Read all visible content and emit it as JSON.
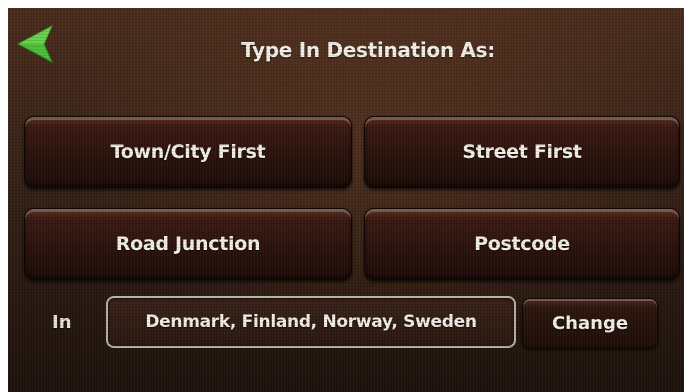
{
  "header": {
    "title": "Type In Destination As:",
    "back_icon": "back-arrow-icon",
    "back_icon_color": "#4fbf3a"
  },
  "options": {
    "town_city_first": "Town/City First",
    "street_first": "Street First",
    "road_junction": "Road Junction",
    "postcode": "Postcode"
  },
  "region": {
    "label": "In",
    "value": "Denmark, Finland, Norway, Sweden",
    "change_label": "Change"
  },
  "colors": {
    "background": "#3a2418",
    "button": "#2a120c",
    "text": "#f2efe8"
  }
}
